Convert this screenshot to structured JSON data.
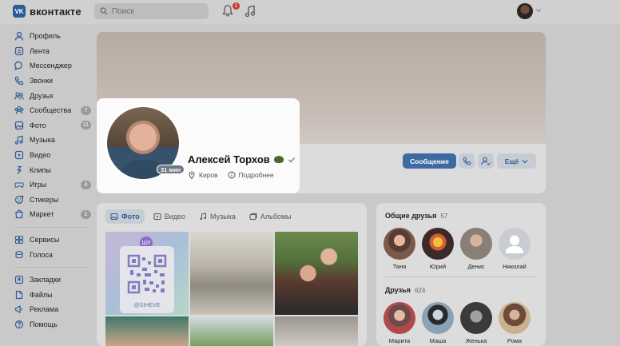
{
  "topbar": {
    "logo_text": "вконтакте",
    "search_placeholder": "Поиск",
    "notifications_count": "1"
  },
  "sidebar": {
    "items": [
      {
        "label": "Профиль",
        "icon": "user-icon",
        "count": ""
      },
      {
        "label": "Лента",
        "icon": "feed-icon",
        "count": ""
      },
      {
        "label": "Мессенджер",
        "icon": "messenger-icon",
        "count": ""
      },
      {
        "label": "Звонки",
        "icon": "phone-icon",
        "count": ""
      },
      {
        "label": "Друзья",
        "icon": "friends-icon",
        "count": ""
      },
      {
        "label": "Сообщества",
        "icon": "communities-icon",
        "count": "7"
      },
      {
        "label": "Фото",
        "icon": "photo-icon",
        "count": "11"
      },
      {
        "label": "Музыка",
        "icon": "music-icon",
        "count": ""
      },
      {
        "label": "Видео",
        "icon": "video-icon",
        "count": ""
      },
      {
        "label": "Клипы",
        "icon": "clips-icon",
        "count": ""
      },
      {
        "label": "Игры",
        "icon": "games-icon",
        "count": "4"
      },
      {
        "label": "Стикеры",
        "icon": "stickers-icon",
        "count": ""
      },
      {
        "label": "Маркет",
        "icon": "market-icon",
        "count": "1"
      }
    ],
    "items2": [
      {
        "label": "Сервисы",
        "icon": "services-icon"
      },
      {
        "label": "Голоса",
        "icon": "votes-icon"
      }
    ],
    "items3": [
      {
        "label": "Закладки",
        "icon": "bookmark-icon"
      },
      {
        "label": "Файлы",
        "icon": "files-icon"
      },
      {
        "label": "Реклама",
        "icon": "ads-icon"
      },
      {
        "label": "Помощь",
        "icon": "help-icon"
      }
    ]
  },
  "profile": {
    "name": "Алексей Торхов",
    "online": "31 мин",
    "city": "Киров",
    "more": "Подробнее",
    "message_button": "Сообщение",
    "more_button": "Ещё"
  },
  "tabs": [
    "Фото",
    "Видео",
    "Музыка",
    "Альбомы"
  ],
  "photos": {
    "qr_badge": "ШУ",
    "qr_handle": "@SIHEVE"
  },
  "common_friends": {
    "title": "Общие друзья",
    "count": "57",
    "names": [
      "Таня",
      "Юрий",
      "Денис",
      "Николай"
    ]
  },
  "friends": {
    "title": "Друзья",
    "count": "624",
    "names": [
      "Марита",
      "Маша",
      "Женька",
      "Рома"
    ]
  },
  "colors": {
    "accent": "#3d6aa0",
    "notification": "#c2392e"
  }
}
